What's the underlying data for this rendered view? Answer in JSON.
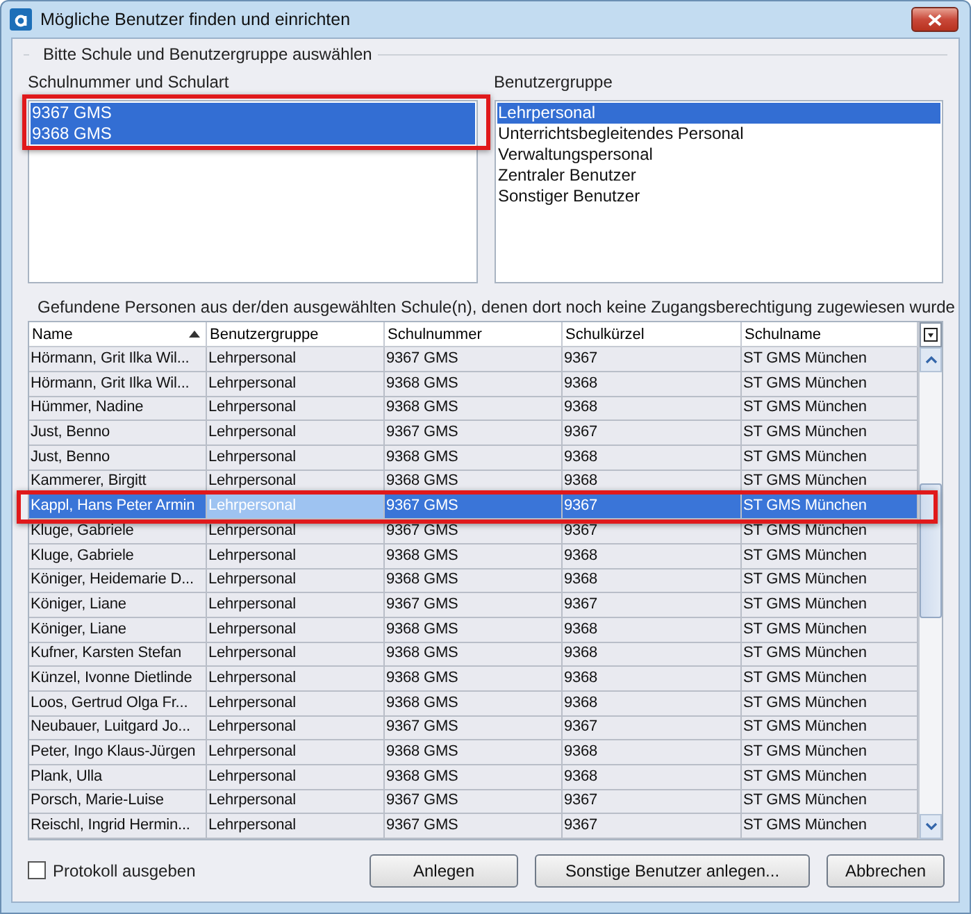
{
  "window": {
    "title": "Mögliche Benutzer finden und einrichten"
  },
  "selection_group": {
    "title": "Bitte Schule und Benutzergruppe auswählen",
    "school_list": {
      "label": "Schulnummer und Schulart",
      "highlighted": true,
      "items": [
        {
          "label": "9367 GMS",
          "selected": true
        },
        {
          "label": "9368 GMS",
          "selected": true
        }
      ]
    },
    "group_list": {
      "label": "Benutzergruppe",
      "items": [
        {
          "label": "Lehrpersonal",
          "selected": true
        },
        {
          "label": "Unterrichtsbegleitendes Personal",
          "selected": false
        },
        {
          "label": "Verwaltungspersonal",
          "selected": false
        },
        {
          "label": "Zentraler Benutzer",
          "selected": false
        },
        {
          "label": "Sonstiger Benutzer",
          "selected": false
        }
      ]
    }
  },
  "results_group": {
    "title": "Gefundene Personen aus der/den ausgewählten Schule(n), denen dort noch keine Zugangsberechtigung zugewiesen wurde",
    "table": {
      "columns": [
        {
          "label": "Name",
          "sorted": true
        },
        {
          "label": "Benutzergruppe",
          "sorted": false
        },
        {
          "label": "Schulnummer",
          "sorted": false
        },
        {
          "label": "Schulkürzel",
          "sorted": false
        },
        {
          "label": "Schulname",
          "sorted": false
        }
      ],
      "rows": [
        {
          "cells": [
            "Hörmann, Grit Ilka Wil...",
            "Lehrpersonal",
            "9367 GMS",
            "9367",
            "ST GMS München"
          ],
          "selected": false,
          "highlighted": false
        },
        {
          "cells": [
            "Hörmann, Grit Ilka Wil...",
            "Lehrpersonal",
            "9368 GMS",
            "9368",
            "ST GMS München"
          ],
          "selected": false,
          "highlighted": false
        },
        {
          "cells": [
            "Hümmer, Nadine",
            "Lehrpersonal",
            "9368 GMS",
            "9368",
            "ST GMS München"
          ],
          "selected": false,
          "highlighted": false
        },
        {
          "cells": [
            "Just, Benno",
            "Lehrpersonal",
            "9367 GMS",
            "9367",
            "ST GMS München"
          ],
          "selected": false,
          "highlighted": false
        },
        {
          "cells": [
            "Just, Benno",
            "Lehrpersonal",
            "9368 GMS",
            "9368",
            "ST GMS München"
          ],
          "selected": false,
          "highlighted": false
        },
        {
          "cells": [
            "Kammerer, Birgitt",
            "Lehrpersonal",
            "9368 GMS",
            "9368",
            "ST GMS München"
          ],
          "selected": false,
          "highlighted": false
        },
        {
          "cells": [
            "Kappl, Hans Peter Armin",
            "Lehrpersonal",
            "9367 GMS",
            "9367",
            "ST GMS München"
          ],
          "selected": true,
          "highlighted": true
        },
        {
          "cells": [
            "Kluge, Gabriele",
            "Lehrpersonal",
            "9367 GMS",
            "9367",
            "ST GMS München"
          ],
          "selected": false,
          "highlighted": false
        },
        {
          "cells": [
            "Kluge, Gabriele",
            "Lehrpersonal",
            "9368 GMS",
            "9368",
            "ST GMS München"
          ],
          "selected": false,
          "highlighted": false
        },
        {
          "cells": [
            "Königer, Heidemarie D...",
            "Lehrpersonal",
            "9368 GMS",
            "9368",
            "ST GMS München"
          ],
          "selected": false,
          "highlighted": false
        },
        {
          "cells": [
            "Königer, Liane",
            "Lehrpersonal",
            "9367 GMS",
            "9367",
            "ST GMS München"
          ],
          "selected": false,
          "highlighted": false
        },
        {
          "cells": [
            "Königer, Liane",
            "Lehrpersonal",
            "9368 GMS",
            "9368",
            "ST GMS München"
          ],
          "selected": false,
          "highlighted": false
        },
        {
          "cells": [
            "Kufner, Karsten Stefan",
            "Lehrpersonal",
            "9368 GMS",
            "9368",
            "ST GMS München"
          ],
          "selected": false,
          "highlighted": false
        },
        {
          "cells": [
            "Künzel, Ivonne Dietlinde",
            "Lehrpersonal",
            "9368 GMS",
            "9368",
            "ST GMS München"
          ],
          "selected": false,
          "highlighted": false
        },
        {
          "cells": [
            "Loos, Gertrud Olga Fr...",
            "Lehrpersonal",
            "9368 GMS",
            "9368",
            "ST GMS München"
          ],
          "selected": false,
          "highlighted": false
        },
        {
          "cells": [
            "Neubauer, Luitgard Jo...",
            "Lehrpersonal",
            "9367 GMS",
            "9367",
            "ST GMS München"
          ],
          "selected": false,
          "highlighted": false
        },
        {
          "cells": [
            "Peter, Ingo Klaus-Jürgen",
            "Lehrpersonal",
            "9368 GMS",
            "9368",
            "ST GMS München"
          ],
          "selected": false,
          "highlighted": false
        },
        {
          "cells": [
            "Plank, Ulla",
            "Lehrpersonal",
            "9368 GMS",
            "9368",
            "ST GMS München"
          ],
          "selected": false,
          "highlighted": false
        },
        {
          "cells": [
            "Porsch, Marie-Luise",
            "Lehrpersonal",
            "9367 GMS",
            "9367",
            "ST GMS München"
          ],
          "selected": false,
          "highlighted": false
        },
        {
          "cells": [
            "Reischl, Ingrid Hermin...",
            "Lehrpersonal",
            "9367 GMS",
            "9367",
            "ST GMS München"
          ],
          "selected": false,
          "highlighted": false
        }
      ]
    }
  },
  "footer": {
    "checkbox": {
      "label": "Protokoll ausgeben",
      "checked": false
    },
    "buttons": [
      "Anlegen",
      "Sonstige Benutzer anlegen...",
      "Abbrechen"
    ]
  }
}
